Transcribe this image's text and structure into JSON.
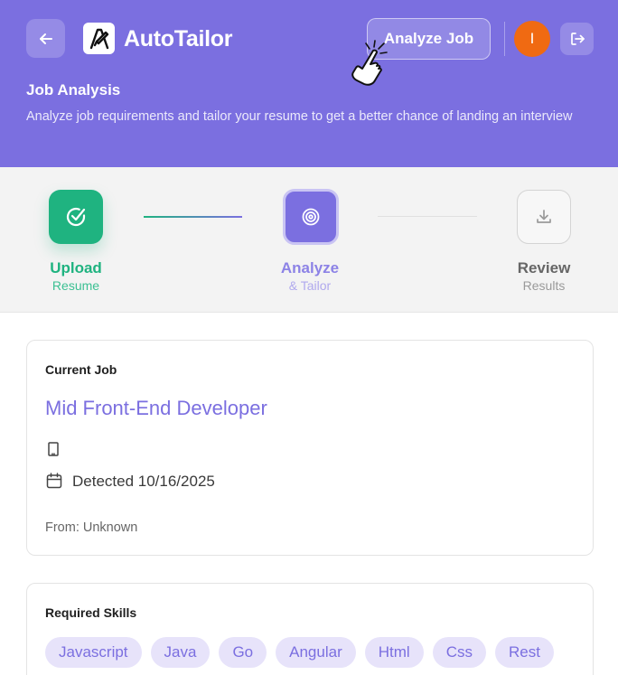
{
  "header": {
    "brand": "AutoTailor",
    "analyze_button": "Analyze Job",
    "avatar_initial": "I",
    "title": "Job Analysis",
    "subtitle": "Analyze job requirements and tailor your resume to get a better chance of landing an interview",
    "accent_color": "#7b6fe0"
  },
  "steps": [
    {
      "label": "Upload",
      "sub": "Resume",
      "status": "complete",
      "icon": "check-circle-icon",
      "color": "#1fb380"
    },
    {
      "label": "Analyze",
      "sub": "& Tailor",
      "status": "active",
      "icon": "target-icon",
      "color": "#7b6fe0"
    },
    {
      "label": "Review",
      "sub": "Results",
      "status": "pending",
      "icon": "download-icon",
      "color": "#9a9a9a"
    }
  ],
  "job": {
    "section_label": "Current Job",
    "title": "Mid Front-End Developer",
    "detected": "Detected 10/16/2025",
    "from": "From: Unknown"
  },
  "skills": {
    "section_label": "Required Skills",
    "items": [
      "Javascript",
      "Java",
      "Go",
      "Angular",
      "Html",
      "Css",
      "Rest"
    ]
  }
}
